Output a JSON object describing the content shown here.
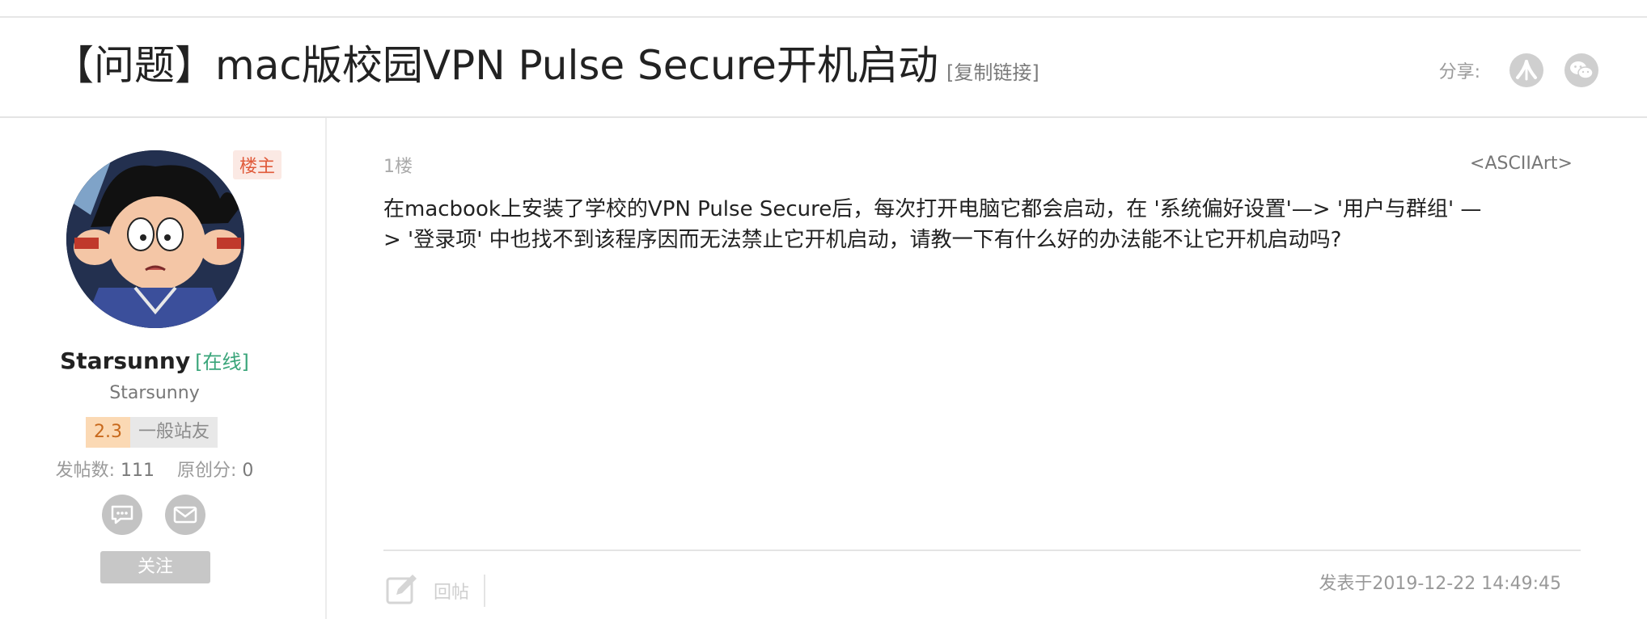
{
  "header": {
    "title": "【问题】mac版校园VPN Pulse Secure开机启动",
    "copy_link": "[复制链接]",
    "share_label": "分享:",
    "share_icons": [
      "renren-icon",
      "wechat-icon"
    ]
  },
  "author": {
    "owner_badge": "楼主",
    "username": "Starsunny",
    "status": "[在线]",
    "nickname": "Starsunny",
    "level_number": "2.3",
    "level_name": "一般站友",
    "posts_label": "发帖数:",
    "posts_value": "111",
    "original_label": "原创分:",
    "original_value": "0",
    "follow_label": "关注"
  },
  "post": {
    "floor": "1楼",
    "ascii_link": "<ASCIIArt>",
    "content": "在macbook上安装了学校的VPN Pulse Secure后，每次打开电脑它都会启动，在 '系统偏好设置'—> '用户与群组' —\n> '登录项' 中也找不到该程序因而无法禁止它开机启动，请教一下有什么好的办法能不让它开机启动吗?",
    "reply_label": "回帖",
    "post_time": "发表于2019-12-22 14:49:45"
  },
  "colors": {
    "online": "#3aa57a",
    "owner_badge": "#e05a3a",
    "level_bg": "#fbd9b4"
  }
}
